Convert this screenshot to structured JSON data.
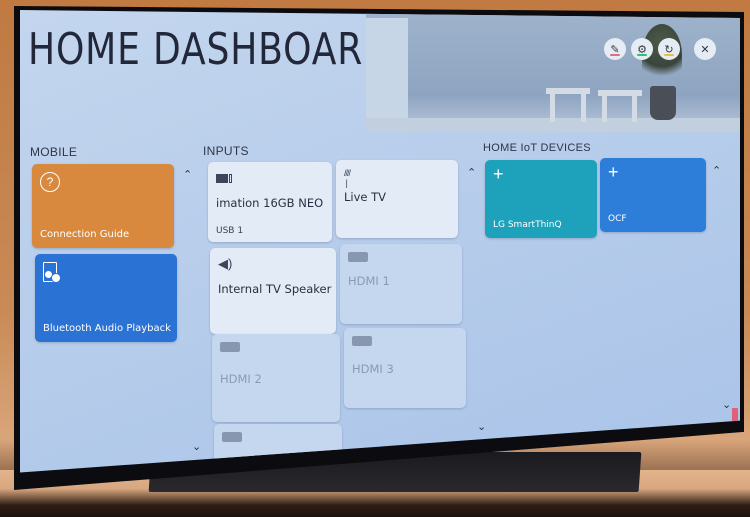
{
  "header": {
    "title": "HOME DASHBOARD",
    "buttons": [
      {
        "name": "edit",
        "icon": "pencil-icon",
        "glyph": "✎",
        "accent": "#e86a86"
      },
      {
        "name": "settings",
        "icon": "gear-icon",
        "glyph": "⚙",
        "accent": "#2fc46a"
      },
      {
        "name": "refresh",
        "icon": "refresh-icon",
        "glyph": "↻",
        "accent": "#e7c23a"
      },
      {
        "name": "close",
        "icon": "close-icon",
        "glyph": "✕",
        "accent": ""
      }
    ]
  },
  "mobile": {
    "label": "MOBILE",
    "items": [
      {
        "label": "Connection Guide",
        "icon": "question-icon",
        "glyph": "?",
        "color": "#d9893d"
      },
      {
        "label": "Bluetooth Audio Playback",
        "icon": "bluetooth-speaker-icon",
        "color": "#2a72d4"
      }
    ],
    "scroll_up": "⌃",
    "scroll_down": "⌄"
  },
  "inputs": {
    "label": "INPUTS",
    "items": [
      {
        "name": "imation 16GB NEO",
        "sub": "USB 1",
        "icon": "usb-icon",
        "active": true
      },
      {
        "name": "Live TV",
        "sub": "",
        "icon": "antenna-icon",
        "active": true
      },
      {
        "name": "Internal TV Speaker",
        "sub": "",
        "icon": "speaker-icon",
        "glyph": "🔈",
        "active": true
      },
      {
        "name": "HDMI 1",
        "sub": "",
        "icon": "hdmi-icon",
        "active": false
      },
      {
        "name": "HDMI 2",
        "sub": "",
        "icon": "hdmi-icon",
        "active": false
      },
      {
        "name": "HDMI 3",
        "sub": "",
        "icon": "hdmi-icon",
        "active": false
      },
      {
        "name": "",
        "sub": "",
        "icon": "hdmi-icon",
        "active": false
      }
    ],
    "scroll_up": "⌃",
    "scroll_down": "⌄"
  },
  "iot": {
    "label": "HOME IoT DEVICES",
    "items": [
      {
        "label": "LG SmartThinQ",
        "icon": "plus-icon",
        "glyph": "+",
        "color": "#1ea2bb"
      },
      {
        "label": "OCF",
        "icon": "plus-icon",
        "glyph": "+",
        "color": "#2d7ed8"
      }
    ],
    "scroll_up": "⌃",
    "scroll_down": "⌄"
  }
}
